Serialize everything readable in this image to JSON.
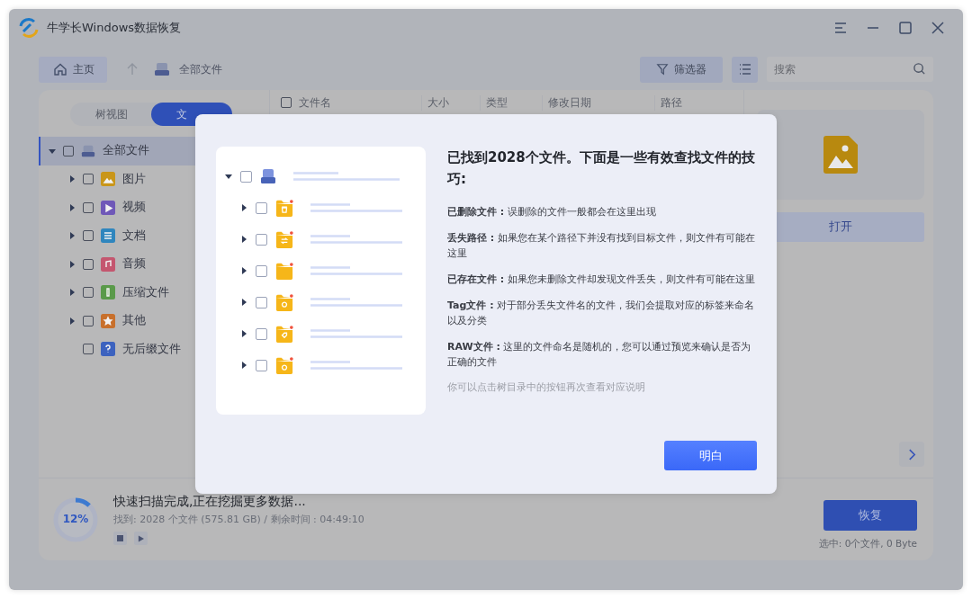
{
  "window": {
    "title": "牛学长Windows数据恢复"
  },
  "toolbar": {
    "home": "主页",
    "location": "全部文件",
    "filter": "筛选器",
    "search_placeholder": "搜索"
  },
  "view_tabs": [
    {
      "label": "树视图",
      "selected": false
    },
    {
      "label": "文",
      "selected": true
    }
  ],
  "tree": [
    {
      "label": "全部文件",
      "kind": "drive",
      "selected": true,
      "checked": false,
      "expanded": true,
      "children": [
        {
          "label": "图片",
          "kind": "image",
          "checked": false,
          "expandable": true
        },
        {
          "label": "视频",
          "kind": "video",
          "checked": false,
          "expandable": true
        },
        {
          "label": "文档",
          "kind": "document",
          "checked": false,
          "expandable": true
        },
        {
          "label": "音频",
          "kind": "audio",
          "checked": false,
          "expandable": true
        },
        {
          "label": "压缩文件",
          "kind": "archive",
          "checked": false,
          "expandable": true
        },
        {
          "label": "其他",
          "kind": "other",
          "checked": false,
          "expandable": true
        },
        {
          "label": "无后缀文件",
          "kind": "unknown",
          "checked": false,
          "expandable": false
        }
      ]
    }
  ],
  "select_all_checked": false,
  "columns": [
    "文件名",
    "大小",
    "类型",
    "修改日期",
    "路径"
  ],
  "preview": {
    "open_button": "打开"
  },
  "scan": {
    "percent": "12%",
    "level": 0.12,
    "title": "快速扫描完成,正在挖掘更多数据...",
    "found": "找到: 2028 个文件 (575.81 GB) /  剩余时间 : 04:49:10"
  },
  "recover_button": "恢复",
  "selection": "选中: 0个文件, 0 Byte",
  "dialog": {
    "title": "已找到2028个文件。下面是一些有效查找文件的技巧:",
    "illustration_rows": [
      {
        "kind": "deleted"
      },
      {
        "kind": "lost-path"
      },
      {
        "kind": "existing"
      },
      {
        "kind": "raw"
      },
      {
        "kind": "tag"
      },
      {
        "kind": "bin"
      }
    ],
    "tips": [
      "**已删除文件 :** 误删除的文件一般都会在这里出现",
      "**丢失路径 :** 如果您在某个路径下并没有找到目标文件，则文件有可能在这里",
      "**已存在文件 :** 如果您未删除文件却发现文件丢失，则文件有可能在这里",
      "**Tag文件 :** 对于部分丢失文件名的文件，我们会提取对应的标签来命名以及分类",
      "**RAW文件 :** 这里的文件命名是随机的，您可以通过预览来确认是否为正确的文件"
    ],
    "note": "你可以点击树目录中的按钮再次查看对应说明",
    "confirm": "明白"
  }
}
